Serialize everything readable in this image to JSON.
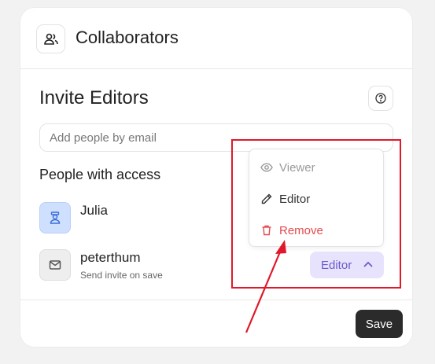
{
  "header": {
    "title": "Collaborators",
    "icon": "users-icon"
  },
  "invite": {
    "title": "Invite Editors",
    "help_icon": "help-circle-icon",
    "email_placeholder": "Add people by email"
  },
  "people": {
    "title": "People with access",
    "list": [
      {
        "name": "Julia",
        "subtitle": "",
        "avatar": "user-avatar-icon"
      },
      {
        "name": "peterthum",
        "subtitle": "Send invite on save",
        "avatar": "mail-icon"
      }
    ]
  },
  "role_selector": {
    "label": "Editor",
    "icon": "chevron-up-icon"
  },
  "role_menu": {
    "items": [
      {
        "label": "Viewer",
        "icon": "eye-icon",
        "state": "disabled"
      },
      {
        "label": "Editor",
        "icon": "pencil-icon",
        "state": "normal"
      },
      {
        "label": "Remove",
        "icon": "trash-icon",
        "state": "danger"
      }
    ]
  },
  "footer": {
    "save_label": "Save"
  },
  "colors": {
    "accent": "#6a5acd",
    "accent_bg": "#e7e3fd",
    "danger": "#e5484d",
    "annotation": "#e0182a",
    "primary_button": "#2b2b2b"
  }
}
